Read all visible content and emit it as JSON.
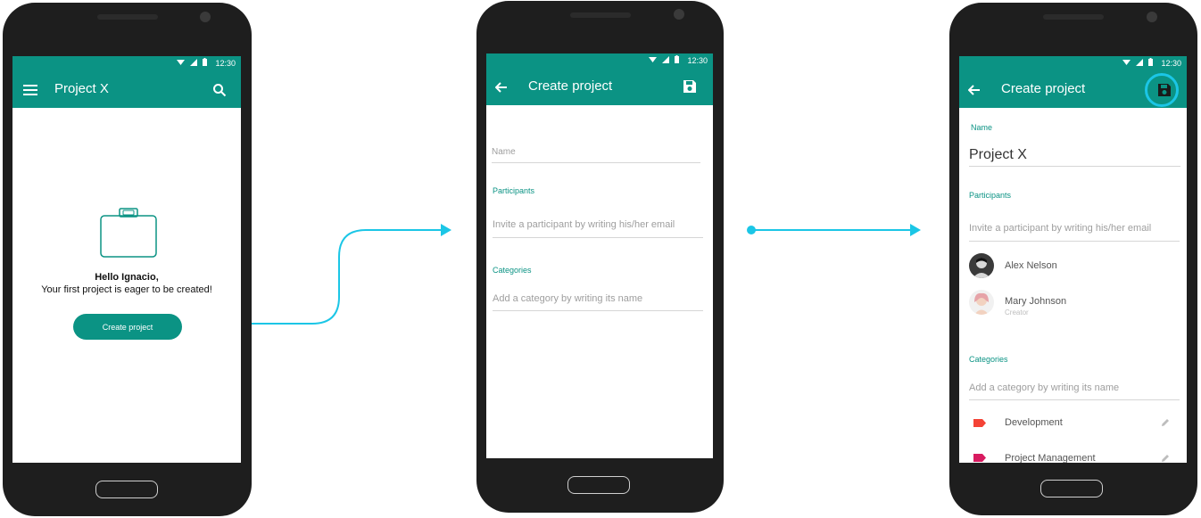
{
  "colors": {
    "primary": "#0b9384",
    "accent_arrow": "#1bc6e6",
    "development_tag": "#f44336",
    "pm_tag": "#d81b60"
  },
  "status_bar": {
    "time": "12:30"
  },
  "screen1": {
    "app_title": "Project X",
    "menu_icon": "menu-icon",
    "search_icon": "search-icon",
    "illustration_icon": "briefcase-icon",
    "greeting": "Hello Ignacio,",
    "message": "Your first project is eager to be created!",
    "create_button": "Create project"
  },
  "screen2": {
    "title": "Create project",
    "name_placeholder": "Name",
    "participants_label": "Participants",
    "participants_placeholder": "Invite a participant by writing his/her email",
    "categories_label": "Categories",
    "categories_placeholder": "Add a category by writing its name"
  },
  "screen3": {
    "title": "Create project",
    "name_label": "Name",
    "name_value": "Project X",
    "participants_label": "Participants",
    "participants_placeholder": "Invite a participant by writing his/her email",
    "participants": [
      {
        "name": "Alex Nelson",
        "role": ""
      },
      {
        "name": "Mary Johnson",
        "role": "Creator"
      }
    ],
    "categories_label": "Categories",
    "categories_placeholder": "Add a category by writing its name",
    "categories": [
      {
        "name": "Development",
        "color": "#f44336"
      },
      {
        "name": "Project Management",
        "color": "#d81b60"
      }
    ]
  }
}
